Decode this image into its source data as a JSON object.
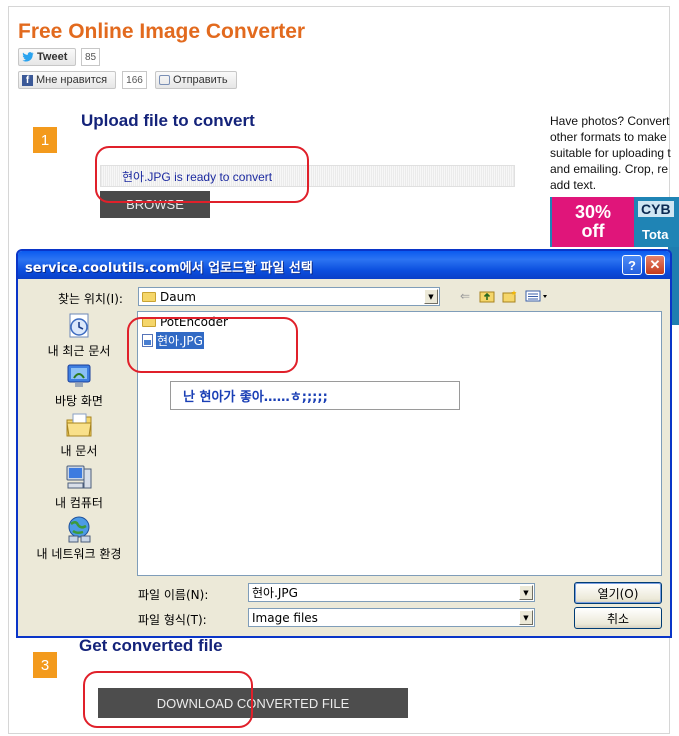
{
  "page": {
    "title": "Free Online Image Converter"
  },
  "social": {
    "tweet_label": "Tweet",
    "tweet_count": "85",
    "like_label": "Мне нравится",
    "like_count": "166",
    "send_label": "Отправить"
  },
  "step1": {
    "number": "1",
    "heading": "Upload file to convert",
    "status_text": "현아.JPG is ready to convert",
    "browse_label": "BROWSE"
  },
  "promo": {
    "lines": [
      "Have photos? Convert",
      "other formats to make",
      "suitable for uploading t",
      "and emailing. Crop, re",
      "add text."
    ],
    "badge_line1": "30%",
    "badge_line2": "off",
    "brand": "CYB",
    "sub": "Tota"
  },
  "dialog": {
    "title": "service.coolutils.com에서 업로드할 파일 선택",
    "help_label": "?",
    "close_label": "✕",
    "look_in_label": "찾는 위치(I):",
    "look_in_value": "Daum",
    "places": [
      {
        "label": "내 최근 문서",
        "icon": "recent-documents-icon"
      },
      {
        "label": "바탕 화면",
        "icon": "desktop-icon"
      },
      {
        "label": "내 문서",
        "icon": "my-documents-icon"
      },
      {
        "label": "내 컴퓨터",
        "icon": "my-computer-icon"
      },
      {
        "label": "내 네트워크 환경",
        "icon": "network-places-icon"
      }
    ],
    "files": [
      {
        "name": "PotEncoder",
        "type": "folder"
      },
      {
        "name": "현아.JPG",
        "type": "jpg",
        "selected": true
      }
    ],
    "annotation": "난 현아가 좋아……ㅎ;;;;;",
    "filename_label": "파일 이름(N):",
    "filename_value": "현아.JPG",
    "filetype_label": "파일 형식(T):",
    "filetype_value": "Image files",
    "open_label": "열기(O)",
    "cancel_label": "취소"
  },
  "step3": {
    "number": "3",
    "heading": "Get converted file",
    "download_label": "DOWNLOAD CONVERTED FILE"
  },
  "colors": {
    "title_orange": "#e26a1e",
    "heading_navy": "#14237a",
    "step_badge": "#f39a1c",
    "highlight_red": "#e0202a",
    "xp_titlebar": "#0a5bf0"
  }
}
